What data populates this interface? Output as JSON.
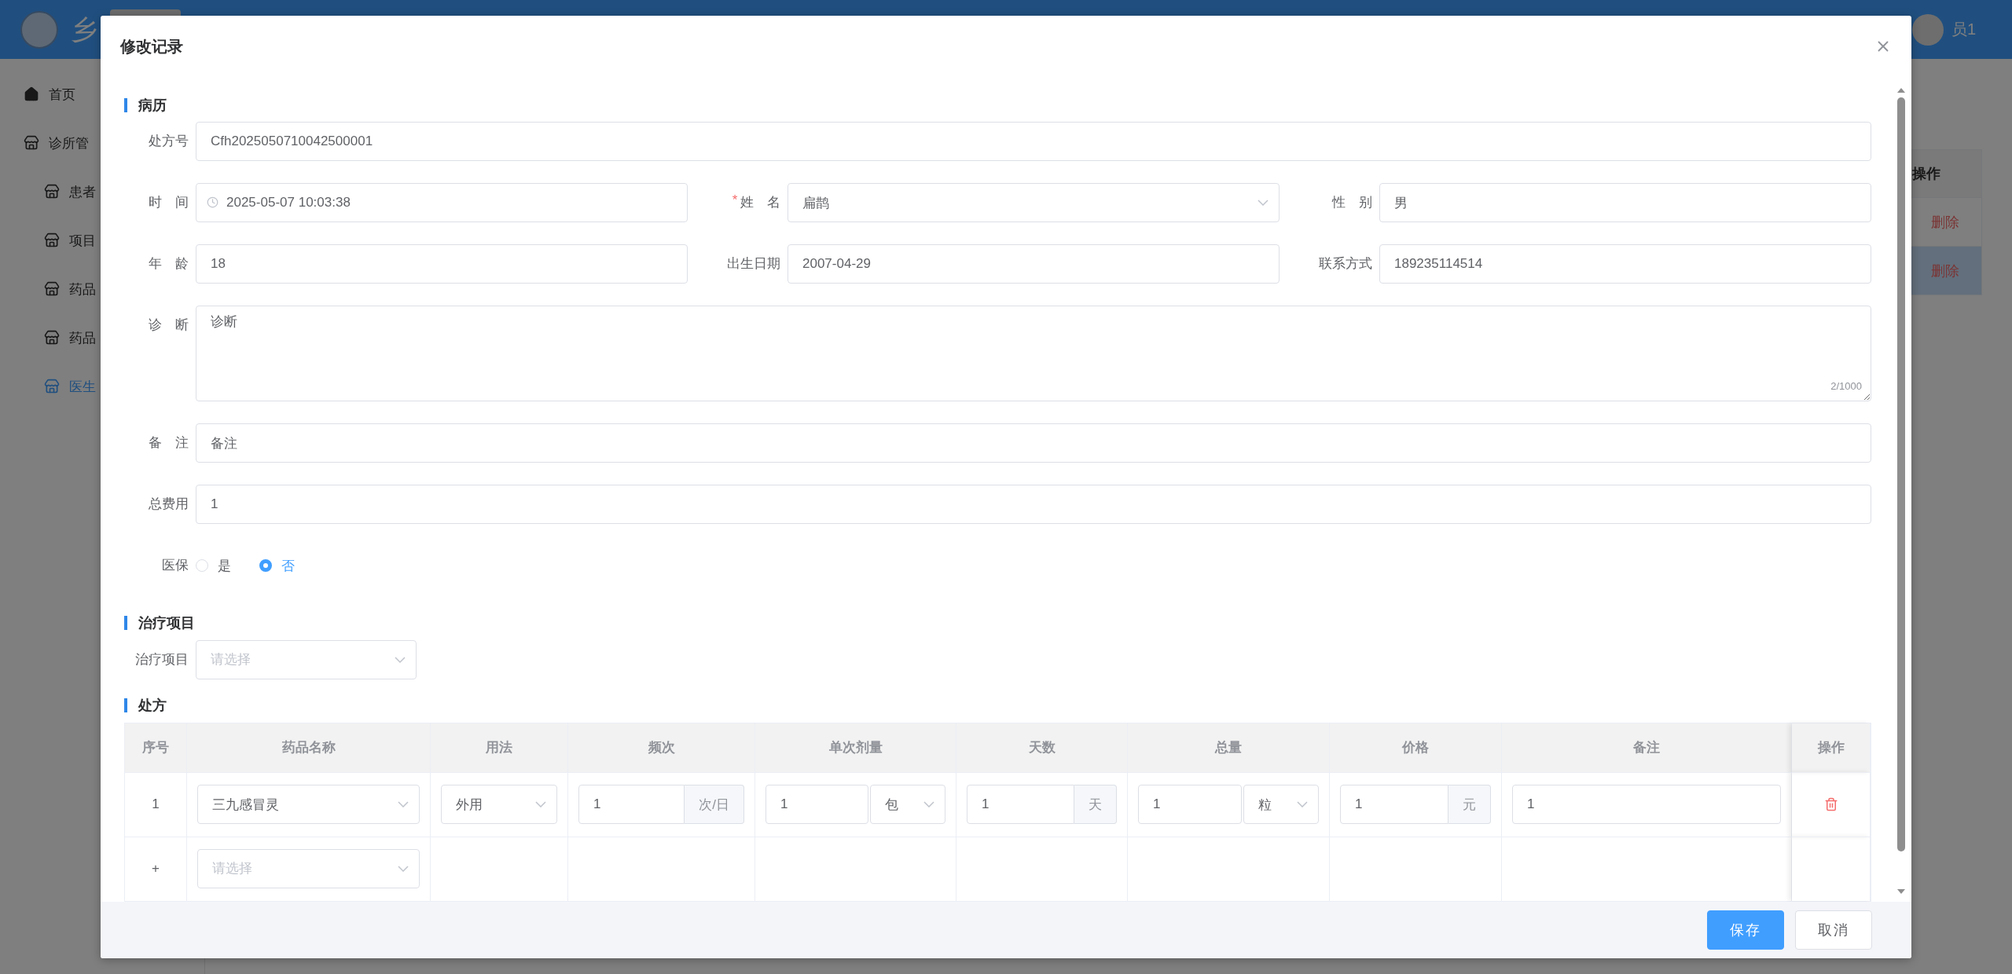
{
  "app_header": {
    "title": "乡",
    "user": "员1"
  },
  "sidebar": {
    "items": [
      {
        "label": "首页",
        "selected": false
      },
      {
        "label": "诊所管",
        "selected": false,
        "children": [
          {
            "label": "患者",
            "selected": false
          },
          {
            "label": "项目",
            "selected": false
          },
          {
            "label": "药品",
            "selected": false
          },
          {
            "label": "药品",
            "selected": false
          },
          {
            "label": "医生",
            "selected": true
          }
        ]
      }
    ]
  },
  "background_table": {
    "columns": [
      "操作"
    ],
    "rows": [
      {
        "action": "删除",
        "highlighted": false
      },
      {
        "action": "删除",
        "highlighted": true
      }
    ]
  },
  "dialog": {
    "title": "修改记录",
    "record": {
      "heading": "病历",
      "rows": [
        [
          {
            "label": "处方号",
            "kind": "text",
            "value": "Cfh2025050710042500001"
          }
        ],
        [
          {
            "label": "时 间",
            "kind": "date",
            "value": "2025-05-07 10:03:38"
          },
          {
            "label": "姓 名",
            "kind": "select",
            "value": "扁鹊",
            "required_mark": "*"
          },
          {
            "label": "性 别",
            "kind": "text",
            "value": "男"
          }
        ],
        [
          {
            "label": "年 龄",
            "kind": "text",
            "value": "18"
          },
          {
            "label": "出生日期",
            "kind": "text",
            "value": "2007-04-29"
          },
          {
            "label": "联系方式",
            "kind": "text",
            "value": "189235114514"
          }
        ],
        [
          {
            "label": "诊 断",
            "kind": "textarea",
            "value": "诊断",
            "counter": "2/1000"
          }
        ],
        [
          {
            "label": "备 注",
            "kind": "text",
            "value": "备注"
          }
        ],
        [
          {
            "label": "总费用",
            "kind": "text",
            "value": "1"
          }
        ],
        [
          {
            "label": "医保",
            "kind": "radio",
            "options": [
              {
                "label": "是",
                "selected": false
              },
              {
                "label": "否",
                "selected": true
              }
            ]
          }
        ]
      ]
    },
    "treatment": {
      "heading": "治疗项目",
      "field": {
        "label": "治疗项目",
        "kind": "select",
        "placeholder": "请选择"
      }
    },
    "prescription": {
      "heading": "处方",
      "table": {
        "columns": [
          "序号",
          "药品名称",
          "用法",
          "频次",
          "单次剂量",
          "天数",
          "总量",
          "价格",
          "备注",
          "操作"
        ],
        "rows": [
          {
            "cells": [
              {
                "kind": "text",
                "value": "1"
              },
              {
                "kind": "select",
                "value": "三九感冒灵"
              },
              {
                "kind": "select",
                "value": "外用"
              },
              {
                "kind": "suffix",
                "value": "1",
                "suffix": "次/日"
              },
              {
                "kind": "unit",
                "value": "1",
                "unit": "包"
              },
              {
                "kind": "suffix",
                "value": "1",
                "suffix": "天"
              },
              {
                "kind": "unit",
                "value": "1",
                "unit": "粒"
              },
              {
                "kind": "suffix",
                "value": "1",
                "suffix": "元"
              },
              {
                "kind": "input",
                "value": "1"
              },
              {
                "kind": "delete"
              }
            ]
          },
          {
            "cells": [
              {
                "kind": "text",
                "value": "+"
              },
              {
                "kind": "select",
                "placeholder": "请选择"
              },
              {
                "kind": "empty"
              },
              {
                "kind": "empty"
              },
              {
                "kind": "empty"
              },
              {
                "kind": "empty"
              },
              {
                "kind": "empty"
              },
              {
                "kind": "empty"
              },
              {
                "kind": "empty"
              },
              {
                "kind": "empty"
              }
            ]
          }
        ]
      }
    },
    "buttons": [
      {
        "label": "保存",
        "kind": "primary"
      },
      {
        "label": "取消",
        "kind": "default"
      }
    ]
  }
}
